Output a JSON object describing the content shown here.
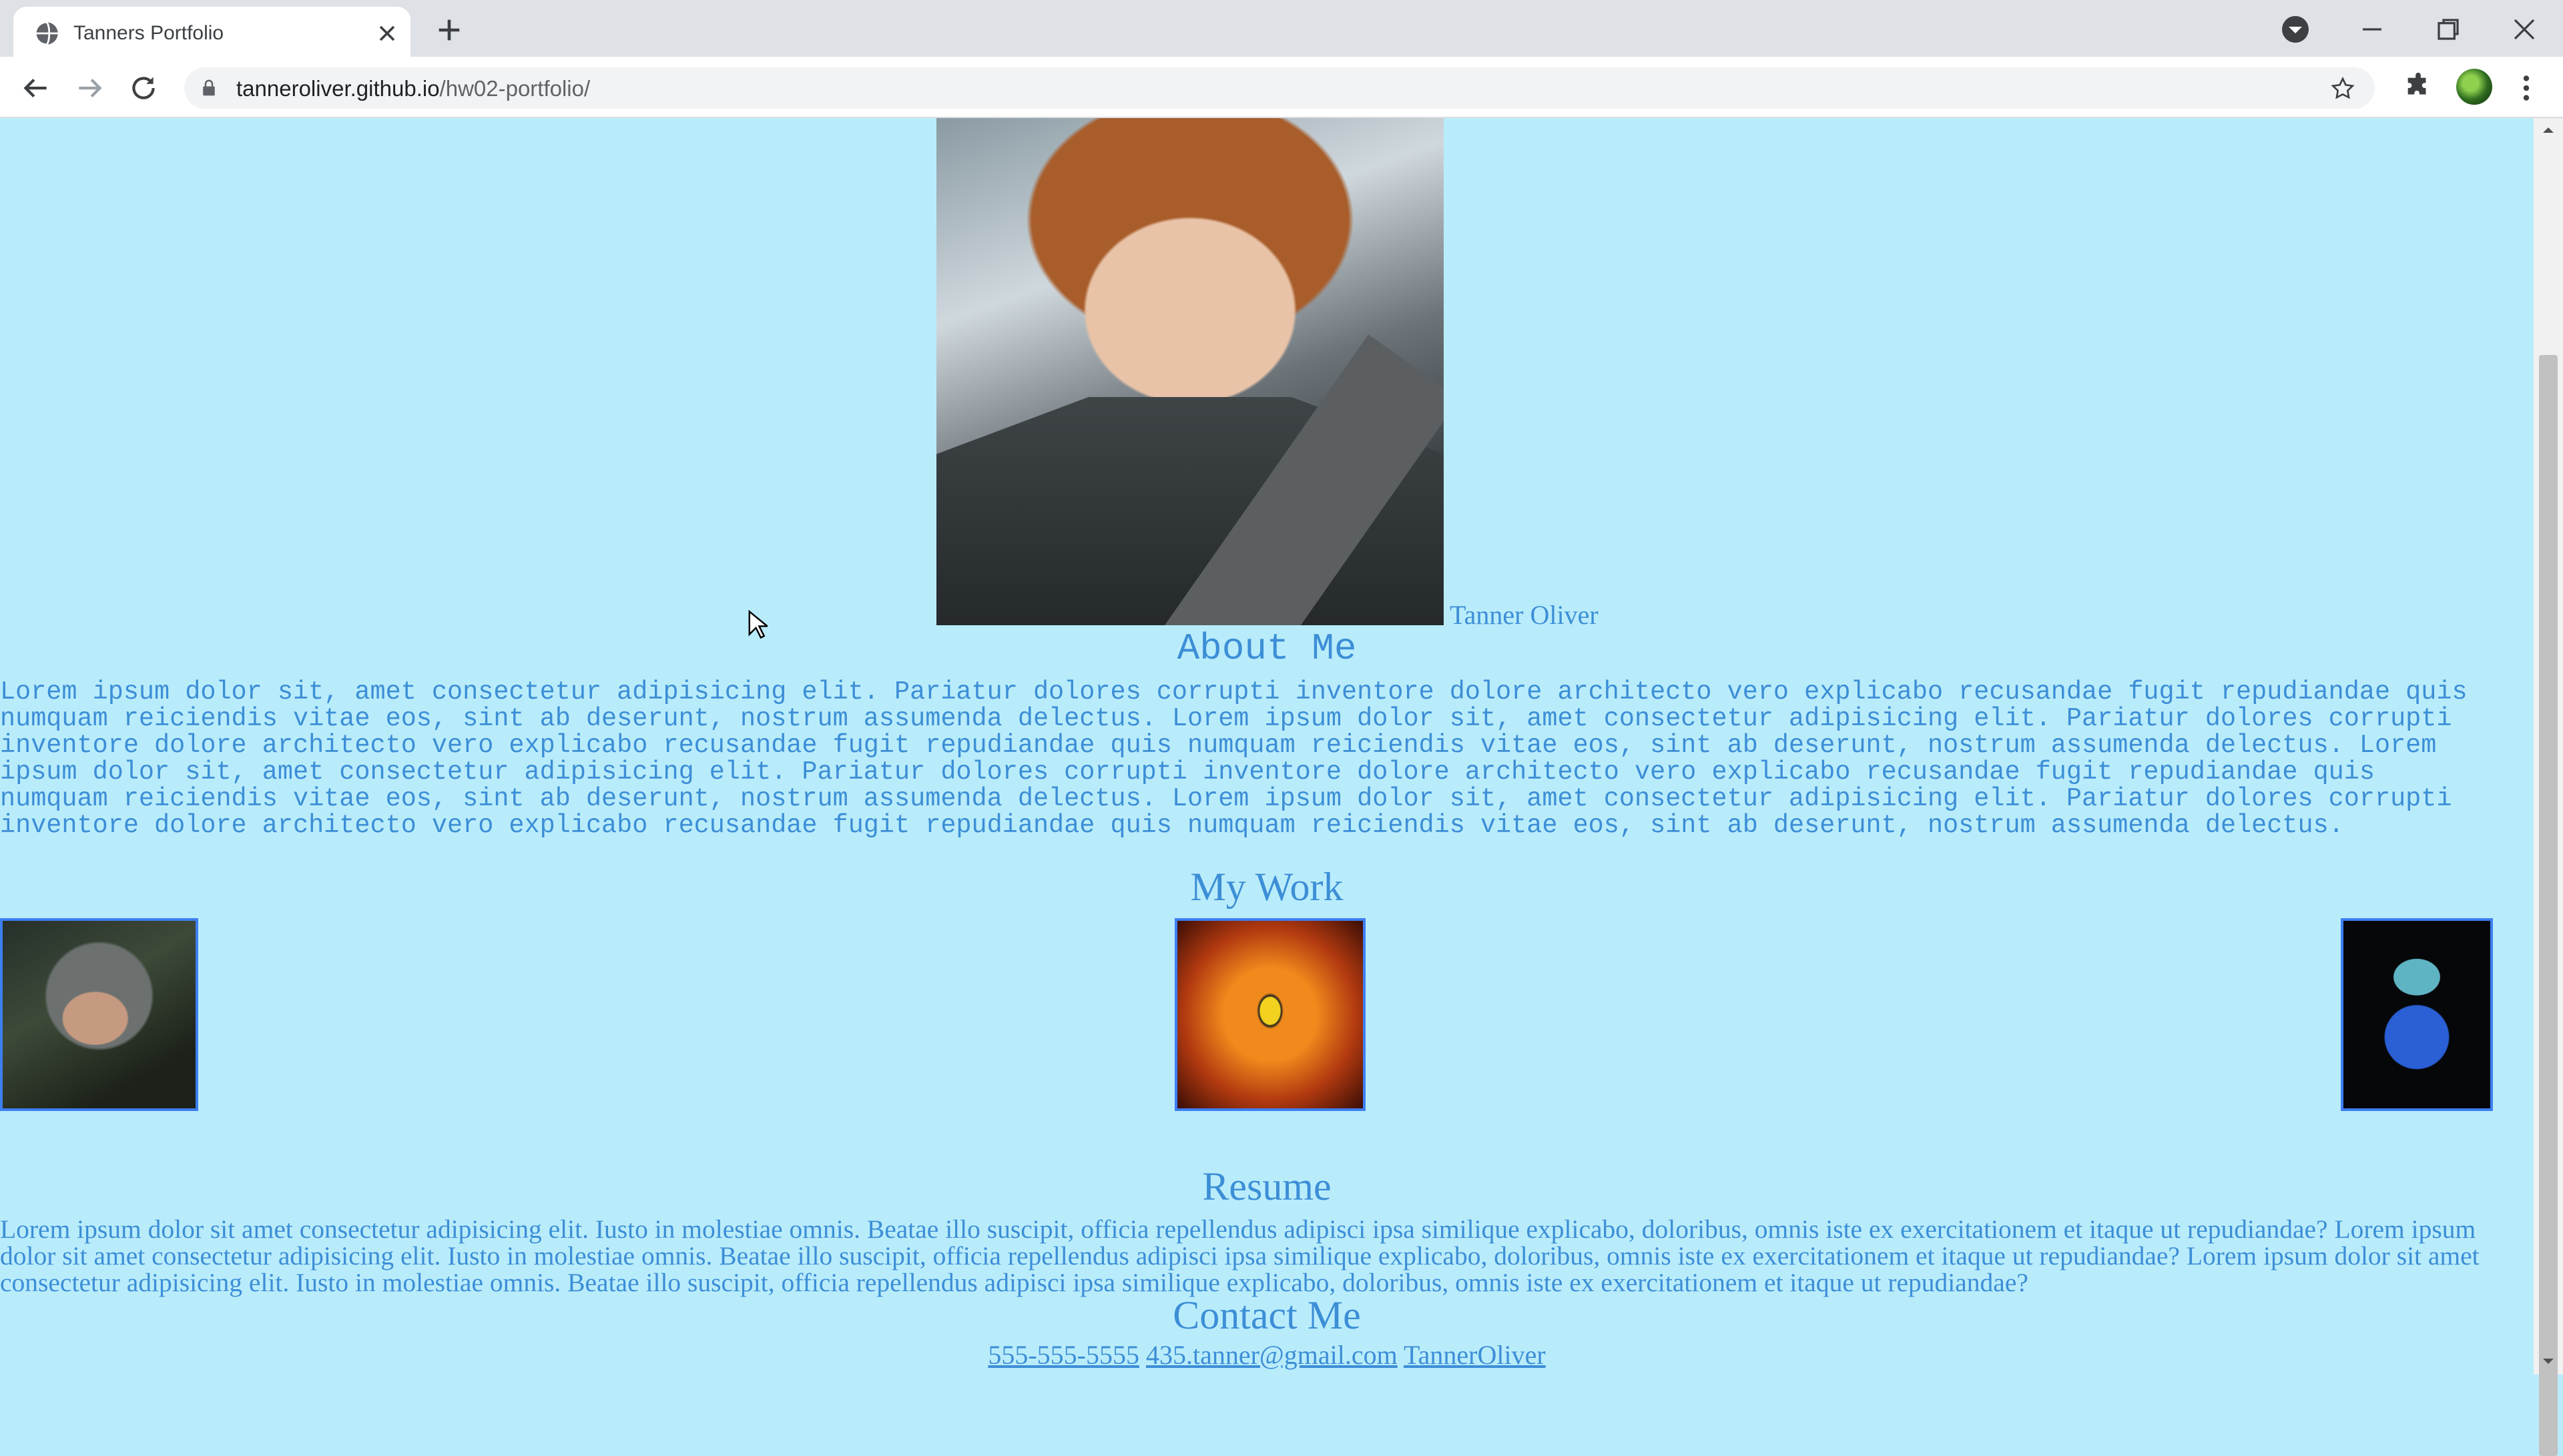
{
  "browser": {
    "tab_title": "Tanners Portfolio",
    "url_host": "tanneroliver.github.io",
    "url_path": "/hw02-portfolio/"
  },
  "profile": {
    "name_link": "Tanner Oliver"
  },
  "about": {
    "heading": "About Me",
    "paragraph": "Lorem ipsum dolor sit, amet consectetur adipisicing elit. Pariatur dolores corrupti inventore dolore architecto vero explicabo recusandae fugit repudiandae quis numquam reiciendis vitae eos, sint ab deserunt, nostrum assumenda delectus. Lorem ipsum dolor sit, amet consectetur adipisicing elit. Pariatur dolores corrupti inventore dolore architecto vero explicabo recusandae fugit repudiandae quis numquam reiciendis vitae eos, sint ab deserunt, nostrum assumenda delectus. Lorem ipsum dolor sit, amet consectetur adipisicing elit. Pariatur dolores corrupti inventore dolore architecto vero explicabo recusandae fugit repudiandae quis numquam reiciendis vitae eos, sint ab deserunt, nostrum assumenda delectus. Lorem ipsum dolor sit, amet consectetur adipisicing elit. Pariatur dolores corrupti inventore dolore architecto vero explicabo recusandae fugit repudiandae quis numquam reiciendis vitae eos, sint ab deserunt, nostrum assumenda delectus."
  },
  "work": {
    "heading": "My Work"
  },
  "resume": {
    "heading": "Resume",
    "paragraph": "Lorem ipsum dolor sit amet consectetur adipisicing elit. Iusto in molestiae omnis. Beatae illo suscipit, officia repellendus adipisci ipsa similique explicabo, doloribus, omnis iste ex exercitationem et itaque ut repudiandae? Lorem ipsum dolor sit amet consectetur adipisicing elit. Iusto in molestiae omnis. Beatae illo suscipit, officia repellendus adipisci ipsa similique explicabo, doloribus, omnis iste ex exercitationem et itaque ut repudiandae? Lorem ipsum dolor sit amet consectetur adipisicing elit. Iusto in molestiae omnis. Beatae illo suscipit, officia repellendus adipisci ipsa similique explicabo, doloribus, omnis iste ex exercitationem et itaque ut repudiandae?"
  },
  "contact": {
    "heading": "Contact Me",
    "phone": "555-555-5555",
    "email": "435.tanner@gmail.com",
    "github": "TannerOliver"
  },
  "colors": {
    "page_background": "#b9ecfb",
    "text_accent": "#3c8ed6",
    "image_border": "#3d7ff2"
  }
}
